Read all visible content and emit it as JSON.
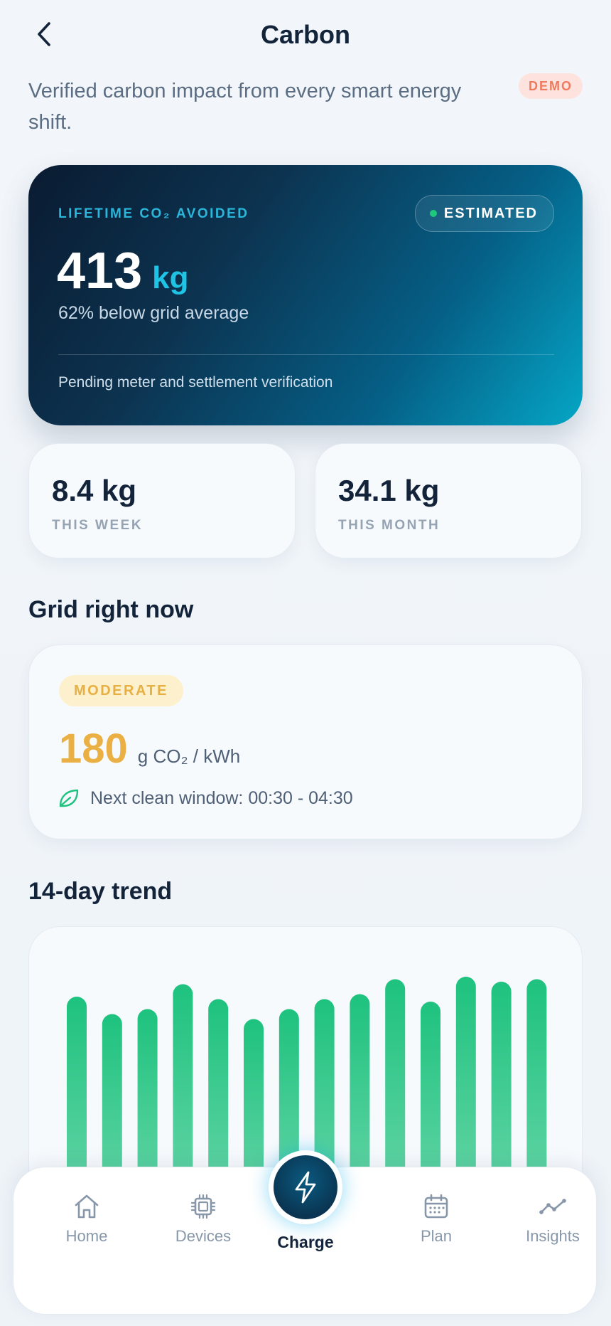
{
  "header": {
    "title": "Carbon",
    "subtitle": "Verified carbon impact from every smart energy shift.",
    "badge": "DEMO"
  },
  "hero": {
    "label": "LIFETIME CO₂ AVOIDED",
    "status": "ESTIMATED",
    "value": "413",
    "unit": "kg",
    "comparison": "62% below grid average",
    "note": "Pending meter and settlement verification"
  },
  "stats": [
    {
      "value": "8.4 kg",
      "label": "THIS WEEK"
    },
    {
      "value": "34.1 kg",
      "label": "THIS MONTH"
    }
  ],
  "grid": {
    "heading": "Grid right now",
    "level": "MODERATE",
    "value": "180",
    "unit": "g CO₂ / kWh",
    "clean_window": "Next clean window: 00:30 - 04:30"
  },
  "trend": {
    "heading": "14-day trend"
  },
  "chart_data": {
    "type": "bar",
    "values": [
      0.92,
      0.85,
      0.87,
      0.97,
      0.91,
      0.83,
      0.87,
      0.91,
      0.93,
      0.99,
      0.9,
      1.0,
      0.98,
      0.99
    ],
    "bar_color": "#1ec27e",
    "ylim": [
      0,
      1
    ]
  },
  "nav": {
    "items": [
      {
        "label": "Home",
        "icon": "home-icon"
      },
      {
        "label": "Devices",
        "icon": "chip-icon"
      },
      {
        "label": "Charge",
        "icon": "bolt-icon"
      },
      {
        "label": "Plan",
        "icon": "calendar-icon"
      },
      {
        "label": "Insights",
        "icon": "trend-line-icon"
      }
    ]
  },
  "colors": {
    "accent": "#1fc3e4",
    "positive": "#1ec27e",
    "warning": "#eab044",
    "demo": "#f07a5d"
  }
}
